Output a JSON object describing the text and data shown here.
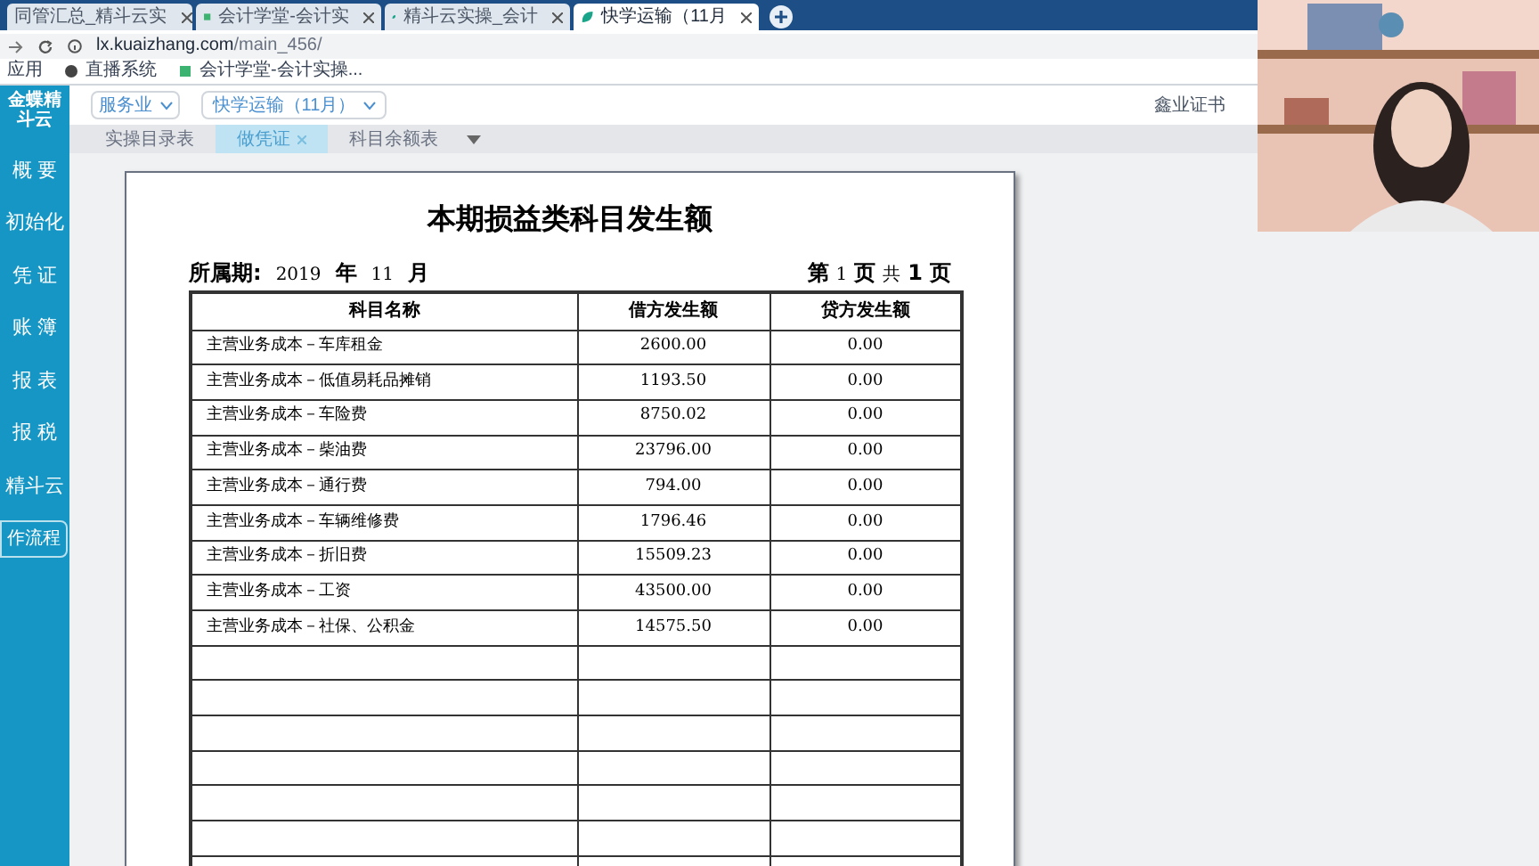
{
  "browser_tabs": [
    {
      "title": "同管汇总_精斗云实",
      "selected": false,
      "kind": "plain"
    },
    {
      "title": "会计学堂-会计实",
      "selected": false,
      "kind": "logo"
    },
    {
      "title": "精斗云实操_会计",
      "selected": false,
      "kind": "leaf"
    },
    {
      "title": "快学运输（11月",
      "selected": true,
      "kind": "leaf"
    }
  ],
  "address": {
    "domain": "lx.kuaizhang.com",
    "path": "/main_456/"
  },
  "bookmarks": [
    "应用",
    "直播系统",
    "会计学堂-会计实操..."
  ],
  "app": {
    "logo": "金蝶精斗云",
    "sidebar": [
      "概 要",
      "初始化",
      "凭 证",
      "账 簿",
      "报 表",
      "报 税",
      "精斗云"
    ],
    "process_button": "作流程",
    "industry": "服务业",
    "company": "快学运输（11月）",
    "right_link": "鑫业证书",
    "tabs": [
      {
        "label": "实操目录表",
        "selected": false,
        "closable": false
      },
      {
        "label": "做凭证",
        "selected": true,
        "closable": true
      },
      {
        "label": "科目余额表",
        "selected": false,
        "closable": false
      }
    ]
  },
  "report": {
    "title": "本期损益类科目发生额",
    "period_label": "所属期:",
    "year": "2019",
    "year_unit": "年",
    "month": "11",
    "month_unit": "月",
    "page_info": [
      "第",
      "1",
      "页",
      "共",
      "1",
      "页"
    ],
    "columns": [
      "科目名称",
      "借方发生额",
      "贷方发生额"
    ],
    "rows": [
      [
        "主营业务成本－车库租金",
        "2600.00",
        "0.00"
      ],
      [
        "主营业务成本－低值易耗品摊销",
        "1193.50",
        "0.00"
      ],
      [
        "主营业务成本－车险费",
        "8750.02",
        "0.00"
      ],
      [
        "主营业务成本－柴油费",
        "23796.00",
        "0.00"
      ],
      [
        "主营业务成本－通行费",
        "794.00",
        "0.00"
      ],
      [
        "主营业务成本－车辆维修费",
        "1796.46",
        "0.00"
      ],
      [
        "主营业务成本－折旧费",
        "15509.23",
        "0.00"
      ],
      [
        "主营业务成本－工资",
        "43500.00",
        "0.00"
      ],
      [
        "主营业务成本－社保、公积金",
        "14575.50",
        "0.00"
      ]
    ]
  },
  "webcam": {
    "kind": "picture"
  }
}
